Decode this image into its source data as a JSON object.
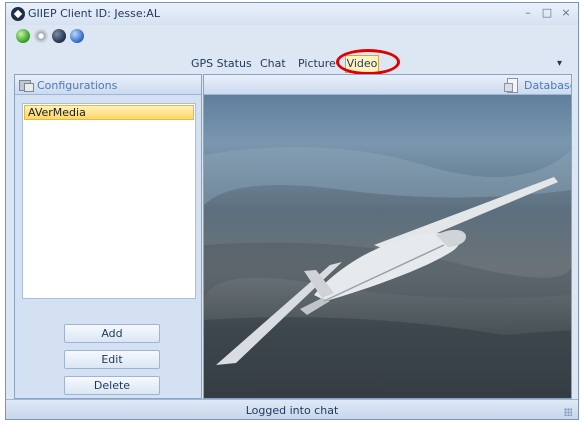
{
  "window": {
    "title": "GIIEP Client ID: Jesse:AL",
    "controls": {
      "minimize": "–",
      "maximize": "□",
      "close": "×"
    }
  },
  "quick_access": {
    "icons": [
      "green-status-icon",
      "gear-icon",
      "globe-icon",
      "help-icon"
    ]
  },
  "tabs": [
    {
      "label": "GPS Status"
    },
    {
      "label": "Chat"
    },
    {
      "label": "Picture"
    },
    {
      "label": "Video",
      "selected": true
    }
  ],
  "ribbon_menu_glyph": "▾",
  "left_panel": {
    "title": "Configurations",
    "items": [
      {
        "label": "AVerMedia",
        "selected": true
      }
    ],
    "buttons": {
      "add": "Add",
      "edit": "Edit",
      "delete": "Delete"
    }
  },
  "right_panel": {
    "title": "Database",
    "content": "video-feed"
  },
  "status_bar": {
    "text": "Logged into chat"
  },
  "colors": {
    "accent_highlight": "#e00000",
    "selected_item": "#fcd766",
    "panel_bg": "#d4e1f2"
  }
}
